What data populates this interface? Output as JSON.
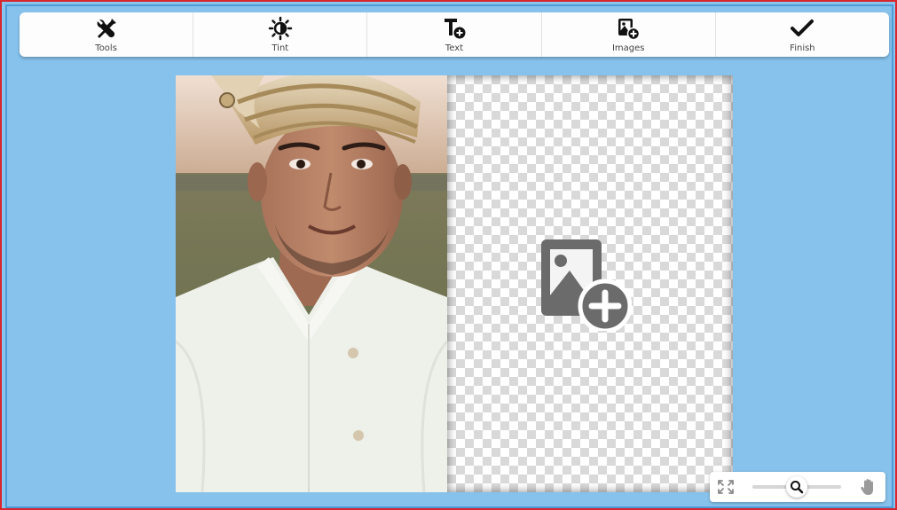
{
  "toolbar": {
    "items": [
      {
        "label": "Tools",
        "icon": "tools-icon"
      },
      {
        "label": "Tint",
        "icon": "tint-icon"
      },
      {
        "label": "Text",
        "icon": "text-add-icon"
      },
      {
        "label": "Images",
        "icon": "image-add-icon"
      },
      {
        "label": "Finish",
        "icon": "checkmark-icon"
      }
    ]
  },
  "canvas": {
    "left_slot": {
      "content": "photo",
      "alt": "Portrait photo of a smiling young man wearing a cream turban and white sherwani"
    },
    "right_slot": {
      "content": "empty",
      "icon": "add-image-icon"
    }
  },
  "zoom_controls": {
    "fit_icon": "fit-screen-icon",
    "slider_icon": "magnifier-icon",
    "pan_icon": "pan-hand-icon"
  },
  "colors": {
    "workspace_bg": "#86c2ec",
    "outer_border": "#d9262c",
    "toolbar_bg": "#fdfdfd",
    "icon_dark": "#111111",
    "placeholder_icon": "#6b6b6b"
  }
}
